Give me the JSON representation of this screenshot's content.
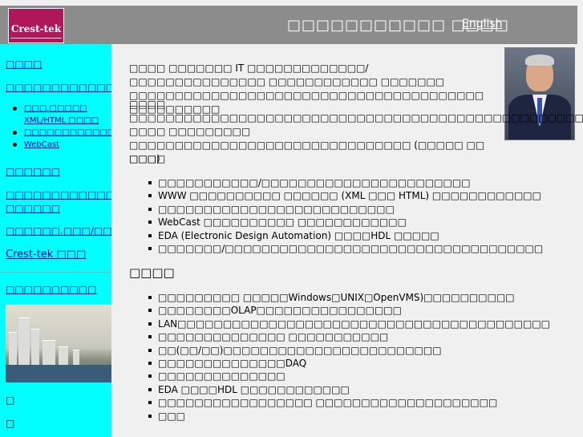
{
  "header": {
    "logo_text": "Crest-tek",
    "title": "□□□□□□□□□□□ □□□□",
    "lang_link": "English"
  },
  "sidebar": {
    "items": [
      {
        "label": "□□□□"
      },
      {
        "label": "□□□□□□□□□□□□□□.□□□□"
      },
      {
        "label": "□□□□□□"
      },
      {
        "label": "□□□□□□□□□□□□.□□□□□□□/□□□□□□"
      },
      {
        "label": "□□□□□□.□□□/□□□□□□"
      },
      {
        "label": "Crest-tek □□□"
      },
      {
        "label": "□□□□□□□□□□"
      }
    ],
    "sub_items": [
      {
        "label": "□□□.□□□□□ XML/HTML □□□□"
      },
      {
        "label": "□□□□□□□□□□□□□□□□□"
      },
      {
        "label": "WebCast"
      }
    ],
    "marks": [
      "□",
      "□"
    ]
  },
  "content": {
    "intro_1": "□□□□ □□□□□□□ IT □□□□□□□□□□□□□/□□□□□□□□□□□□□□□ □□□□□□□□□□□□ □□□□□□□ □□□□□□□□□□□□□□□□□□□□□□□□□□□□□□□□□□□□□□□ □□□□□□□□□□",
    "intro_2": "□□□□ □□□□□□□□□□□□□□□□□□□□□□□□□□□□□□□□□□□□□□□□□□□□□□□□□□□□□ □□□□ □□□□□□□□□ □□□□□□□□□□□□□□□□□□□□□□□□□□□□□□□ (□□□□□ □□ □□□)",
    "section1_title": "□□□□",
    "section1_items": [
      "□□□□□□□□□□□/□□□□□□□□□□□□□□□□□□□□□□□",
      "WWW □□□□□□□□□□ □□□□□□ (XML □□□ HTML) □□□□□□□□□□□□",
      "□□□□□□□□□□□□□□□□□□□□□□□□□□",
      "WebCast □□□□□□□□□□ □□□□□□□□□□□□",
      "EDA (Electronic Design Automation) □□□□HDL □□□□□",
      "□□□□□□□/□□□□□□□□□□□□□□□□□□□□□□□□□□□□□□□□□□□"
    ],
    "section2_title": "□□□□",
    "section2_items": [
      "□□□□□□□□□ □□□□□Windows□UNIX□OpenVMS)□□□□□□□□□□",
      "□□□□□□□□OLAP□□□□□□□□□□□□□□□□",
      "LAN□□□□□□□□□□□□□□□□□□□□□□□□□□□□□□□□□□□□□□□□□",
      "□□□□□□□□□□□□□□ □□□□□□□□□□□",
      "□□(□□/□□)□□□□□□□□□□□□□□□□□□□□□□□□",
      "□□□□□□□□□□□□□□DAQ",
      "□□□□□□□□□□□□□□",
      "EDA □□□□HDL □□□□□□□□□□□□",
      "□□□□□□□□□□□□□□□□□ □□□□□□□□□□□□□□□□□□□□",
      "□□□"
    ]
  }
}
